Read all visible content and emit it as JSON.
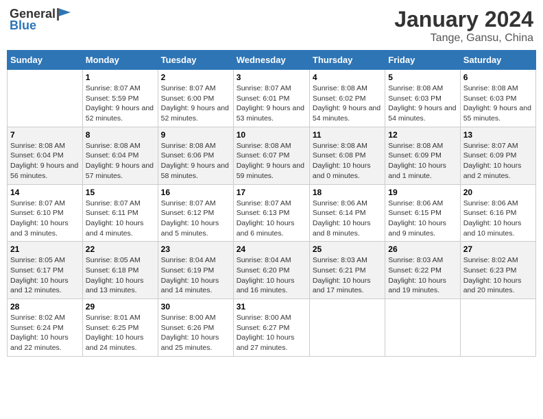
{
  "header": {
    "logo_general": "General",
    "logo_blue": "Blue",
    "title": "January 2024",
    "subtitle": "Tange, Gansu, China"
  },
  "calendar": {
    "days_of_week": [
      "Sunday",
      "Monday",
      "Tuesday",
      "Wednesday",
      "Thursday",
      "Friday",
      "Saturday"
    ],
    "weeks": [
      [
        {
          "day": "",
          "sunrise": "",
          "sunset": "",
          "daylight": ""
        },
        {
          "day": "1",
          "sunrise": "Sunrise: 8:07 AM",
          "sunset": "Sunset: 5:59 PM",
          "daylight": "Daylight: 9 hours and 52 minutes."
        },
        {
          "day": "2",
          "sunrise": "Sunrise: 8:07 AM",
          "sunset": "Sunset: 6:00 PM",
          "daylight": "Daylight: 9 hours and 52 minutes."
        },
        {
          "day": "3",
          "sunrise": "Sunrise: 8:07 AM",
          "sunset": "Sunset: 6:01 PM",
          "daylight": "Daylight: 9 hours and 53 minutes."
        },
        {
          "day": "4",
          "sunrise": "Sunrise: 8:08 AM",
          "sunset": "Sunset: 6:02 PM",
          "daylight": "Daylight: 9 hours and 54 minutes."
        },
        {
          "day": "5",
          "sunrise": "Sunrise: 8:08 AM",
          "sunset": "Sunset: 6:03 PM",
          "daylight": "Daylight: 9 hours and 54 minutes."
        },
        {
          "day": "6",
          "sunrise": "Sunrise: 8:08 AM",
          "sunset": "Sunset: 6:03 PM",
          "daylight": "Daylight: 9 hours and 55 minutes."
        }
      ],
      [
        {
          "day": "7",
          "sunrise": "Sunrise: 8:08 AM",
          "sunset": "Sunset: 6:04 PM",
          "daylight": "Daylight: 9 hours and 56 minutes."
        },
        {
          "day": "8",
          "sunrise": "Sunrise: 8:08 AM",
          "sunset": "Sunset: 6:04 PM",
          "daylight": "Daylight: 9 hours and 57 minutes."
        },
        {
          "day": "9",
          "sunrise": "Sunrise: 8:08 AM",
          "sunset": "Sunset: 6:06 PM",
          "daylight": "Daylight: 9 hours and 58 minutes."
        },
        {
          "day": "10",
          "sunrise": "Sunrise: 8:08 AM",
          "sunset": "Sunset: 6:07 PM",
          "daylight": "Daylight: 9 hours and 59 minutes."
        },
        {
          "day": "11",
          "sunrise": "Sunrise: 8:08 AM",
          "sunset": "Sunset: 6:08 PM",
          "daylight": "Daylight: 10 hours and 0 minutes."
        },
        {
          "day": "12",
          "sunrise": "Sunrise: 8:08 AM",
          "sunset": "Sunset: 6:09 PM",
          "daylight": "Daylight: 10 hours and 1 minute."
        },
        {
          "day": "13",
          "sunrise": "Sunrise: 8:07 AM",
          "sunset": "Sunset: 6:09 PM",
          "daylight": "Daylight: 10 hours and 2 minutes."
        }
      ],
      [
        {
          "day": "14",
          "sunrise": "Sunrise: 8:07 AM",
          "sunset": "Sunset: 6:10 PM",
          "daylight": "Daylight: 10 hours and 3 minutes."
        },
        {
          "day": "15",
          "sunrise": "Sunrise: 8:07 AM",
          "sunset": "Sunset: 6:11 PM",
          "daylight": "Daylight: 10 hours and 4 minutes."
        },
        {
          "day": "16",
          "sunrise": "Sunrise: 8:07 AM",
          "sunset": "Sunset: 6:12 PM",
          "daylight": "Daylight: 10 hours and 5 minutes."
        },
        {
          "day": "17",
          "sunrise": "Sunrise: 8:07 AM",
          "sunset": "Sunset: 6:13 PM",
          "daylight": "Daylight: 10 hours and 6 minutes."
        },
        {
          "day": "18",
          "sunrise": "Sunrise: 8:06 AM",
          "sunset": "Sunset: 6:14 PM",
          "daylight": "Daylight: 10 hours and 8 minutes."
        },
        {
          "day": "19",
          "sunrise": "Sunrise: 8:06 AM",
          "sunset": "Sunset: 6:15 PM",
          "daylight": "Daylight: 10 hours and 9 minutes."
        },
        {
          "day": "20",
          "sunrise": "Sunrise: 8:06 AM",
          "sunset": "Sunset: 6:16 PM",
          "daylight": "Daylight: 10 hours and 10 minutes."
        }
      ],
      [
        {
          "day": "21",
          "sunrise": "Sunrise: 8:05 AM",
          "sunset": "Sunset: 6:17 PM",
          "daylight": "Daylight: 10 hours and 12 minutes."
        },
        {
          "day": "22",
          "sunrise": "Sunrise: 8:05 AM",
          "sunset": "Sunset: 6:18 PM",
          "daylight": "Daylight: 10 hours and 13 minutes."
        },
        {
          "day": "23",
          "sunrise": "Sunrise: 8:04 AM",
          "sunset": "Sunset: 6:19 PM",
          "daylight": "Daylight: 10 hours and 14 minutes."
        },
        {
          "day": "24",
          "sunrise": "Sunrise: 8:04 AM",
          "sunset": "Sunset: 6:20 PM",
          "daylight": "Daylight: 10 hours and 16 minutes."
        },
        {
          "day": "25",
          "sunrise": "Sunrise: 8:03 AM",
          "sunset": "Sunset: 6:21 PM",
          "daylight": "Daylight: 10 hours and 17 minutes."
        },
        {
          "day": "26",
          "sunrise": "Sunrise: 8:03 AM",
          "sunset": "Sunset: 6:22 PM",
          "daylight": "Daylight: 10 hours and 19 minutes."
        },
        {
          "day": "27",
          "sunrise": "Sunrise: 8:02 AM",
          "sunset": "Sunset: 6:23 PM",
          "daylight": "Daylight: 10 hours and 20 minutes."
        }
      ],
      [
        {
          "day": "28",
          "sunrise": "Sunrise: 8:02 AM",
          "sunset": "Sunset: 6:24 PM",
          "daylight": "Daylight: 10 hours and 22 minutes."
        },
        {
          "day": "29",
          "sunrise": "Sunrise: 8:01 AM",
          "sunset": "Sunset: 6:25 PM",
          "daylight": "Daylight: 10 hours and 24 minutes."
        },
        {
          "day": "30",
          "sunrise": "Sunrise: 8:00 AM",
          "sunset": "Sunset: 6:26 PM",
          "daylight": "Daylight: 10 hours and 25 minutes."
        },
        {
          "day": "31",
          "sunrise": "Sunrise: 8:00 AM",
          "sunset": "Sunset: 6:27 PM",
          "daylight": "Daylight: 10 hours and 27 minutes."
        },
        {
          "day": "",
          "sunrise": "",
          "sunset": "",
          "daylight": ""
        },
        {
          "day": "",
          "sunrise": "",
          "sunset": "",
          "daylight": ""
        },
        {
          "day": "",
          "sunrise": "",
          "sunset": "",
          "daylight": ""
        }
      ]
    ]
  }
}
